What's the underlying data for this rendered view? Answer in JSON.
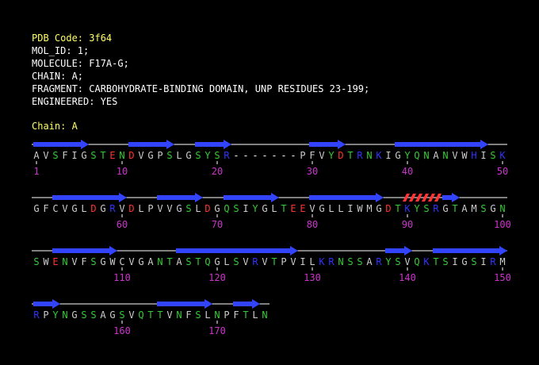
{
  "header": {
    "pdb_code_label": "PDB Code: 3f64",
    "lines": [
      "MOL_ID: 1;",
      "MOLECULE: F17A-G;",
      "CHAIN: A;",
      "FRAGMENT: CARBOHYDRATE-BINDING DOMAIN, UNP RESIDUES 23-199;",
      "ENGINEERED: YES"
    ]
  },
  "chain": {
    "label": "Chain: A"
  },
  "colors": {
    "hydrophobic": "#cccccc",
    "polar": "#33cc33",
    "acidic": "#ff3333",
    "basic": "#3333ff",
    "gap": "#ffffff",
    "strand": "#3344ff",
    "helix": "#ff3333",
    "number": "#cc33cc",
    "line": "#ffffff"
  },
  "rows": [
    {
      "sequence": "AVSFIGSTENDVGPSLGSYSR-------PFVYDTRNKIGYQNANVWHISK",
      "numbers": [
        {
          "label": "1",
          "col": 0
        },
        {
          "label": "10",
          "col": 9
        },
        {
          "label": "20",
          "col": 19
        },
        {
          "label": "30",
          "col": 29
        },
        {
          "label": "40",
          "col": 39
        },
        {
          "label": "50",
          "col": 49
        }
      ],
      "strands": [
        [
          0,
          5
        ],
        [
          10,
          14
        ],
        [
          17,
          20
        ],
        [
          29,
          32
        ],
        [
          38,
          47
        ]
      ],
      "helices": [],
      "line_cols": [
        0,
        49
      ]
    },
    {
      "sequence": "GFCVGLDGRVDLPVVGSLDGQSIYGLTEEVGLLIWMGDTKYSRGTAMSGN",
      "numbers": [
        {
          "label": "60",
          "col": 9
        },
        {
          "label": "70",
          "col": 19
        },
        {
          "label": "80",
          "col": 29
        },
        {
          "label": "90",
          "col": 39
        },
        {
          "label": "100",
          "col": 49
        }
      ],
      "strands": [
        [
          2,
          9
        ],
        [
          13,
          17
        ],
        [
          20,
          25
        ],
        [
          29,
          36
        ],
        [
          43,
          44
        ]
      ],
      "helices": [
        [
          39,
          42
        ]
      ],
      "line_cols": [
        0,
        49
      ]
    },
    {
      "sequence": "SWENVFSGWCVGANTASTQGLSVRVTPVILKRNSSARYSVQKTSIGSIRM",
      "numbers": [
        {
          "label": "110",
          "col": 9
        },
        {
          "label": "120",
          "col": 19
        },
        {
          "label": "130",
          "col": 29
        },
        {
          "label": "140",
          "col": 39
        },
        {
          "label": "150",
          "col": 49
        }
      ],
      "strands": [
        [
          2,
          8
        ],
        [
          15,
          27
        ],
        [
          37,
          39
        ],
        [
          42,
          49
        ]
      ],
      "helices": [],
      "line_cols": [
        0,
        49
      ]
    },
    {
      "sequence": "RPYNGSSAGSVQTTVNFSLNPFTLN",
      "numbers": [
        {
          "label": "160",
          "col": 9
        },
        {
          "label": "170",
          "col": 19
        }
      ],
      "strands": [
        [
          0,
          2
        ],
        [
          13,
          18
        ],
        [
          21,
          23
        ]
      ],
      "helices": [],
      "line_cols": [
        0,
        24
      ]
    }
  ]
}
